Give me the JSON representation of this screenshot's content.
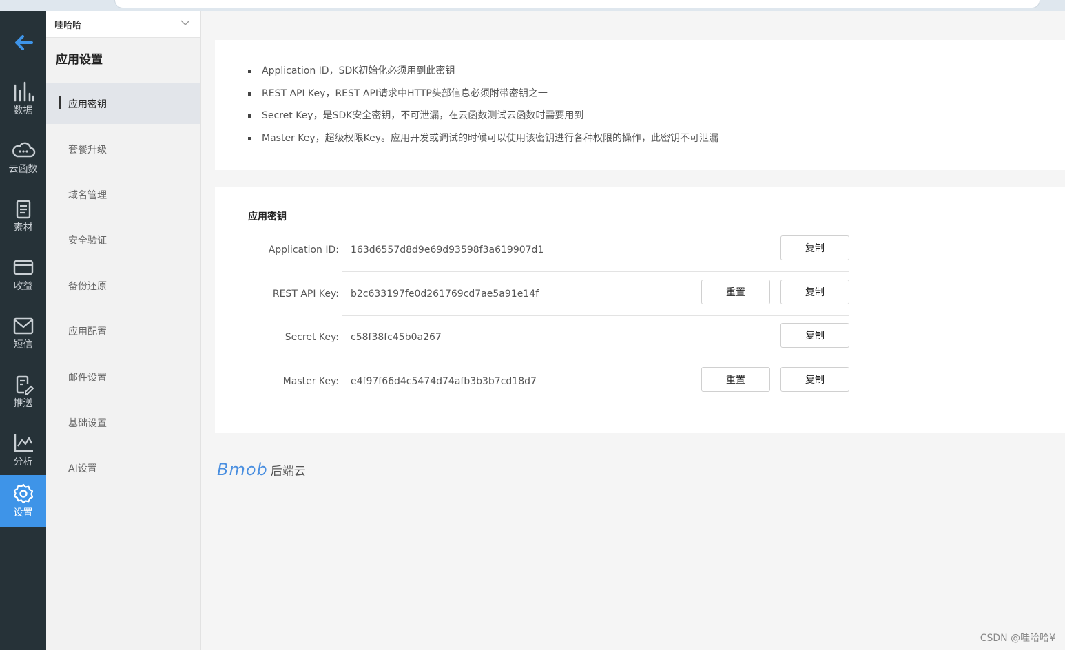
{
  "rail": {
    "items": [
      {
        "label": "数据",
        "icon": "bar-chart-icon"
      },
      {
        "label": "云函数",
        "icon": "cloud-icon"
      },
      {
        "label": "素材",
        "icon": "document-icon"
      },
      {
        "label": "收益",
        "icon": "card-icon"
      },
      {
        "label": "短信",
        "icon": "mail-icon"
      },
      {
        "label": "推送",
        "icon": "edit-doc-icon"
      },
      {
        "label": "分析",
        "icon": "line-chart-icon"
      },
      {
        "label": "设置",
        "icon": "gear-icon",
        "active": true
      }
    ],
    "active_color": "#3e94e8",
    "background": "#263238"
  },
  "sidebar": {
    "app_name": "哇哈哈",
    "title": "应用设置",
    "items": [
      {
        "label": "应用密钥",
        "active": true
      },
      {
        "label": "套餐升级"
      },
      {
        "label": "域名管理"
      },
      {
        "label": "安全验证"
      },
      {
        "label": "备份还原"
      },
      {
        "label": "应用配置"
      },
      {
        "label": "邮件设置"
      },
      {
        "label": "基础设置"
      },
      {
        "label": "AI设置"
      }
    ]
  },
  "info": {
    "bullets": [
      "Application ID，SDK初始化必须用到此密钥",
      "REST API Key，REST API请求中HTTP头部信息必须附带密钥之一",
      "Secret Key，是SDK安全密钥，不可泄漏，在云函数测试云函数时需要用到",
      "Master Key，超级权限Key。应用开发或调试的时候可以使用该密钥进行各种权限的操作，此密钥不可泄漏"
    ]
  },
  "keys": {
    "title": "应用密钥",
    "copy_label": "复制",
    "reset_label": "重置",
    "rows": [
      {
        "label": "Application ID:",
        "value": "163d6557d8d9e69d93598f3a619907d1",
        "has_reset": false
      },
      {
        "label": "REST API Key:",
        "value": "b2c633197fe0d261769cd7ae5a91e14f",
        "has_reset": true
      },
      {
        "label": "Secret Key:",
        "value": "c58f38fc45b0a267",
        "has_reset": false
      },
      {
        "label": "Master Key:",
        "value": "e4f97f66d4c5474d74afb3b3b7cd18d7",
        "has_reset": true
      }
    ]
  },
  "footer": {
    "logo_text": "Bmob",
    "logo_suffix": "后端云",
    "brand_color": "#4a8fe0"
  },
  "watermark": "CSDN @哇哈哈¥"
}
